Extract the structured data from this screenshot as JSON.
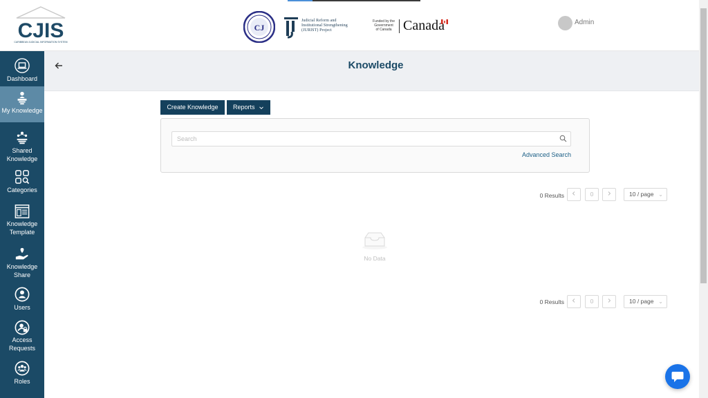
{
  "header": {
    "logo_text": "CJIS",
    "logo_caption": "CARIBBEAN JUDICIAL INFORMATION SYSTEM",
    "seal_text": "CCJ",
    "jurist_lines": [
      "Judicial Reform and",
      "Institutional Strengthening",
      "(JURIST) Project"
    ],
    "funded_lines": [
      "Funded by the",
      "Government",
      "of Canada"
    ],
    "canada_wordmark": "Canada",
    "user_name": "Admin"
  },
  "sidebar": {
    "items": [
      {
        "id": "dashboard",
        "label": "Dashboard",
        "icon": "laptop-icon"
      },
      {
        "id": "my-knowledge",
        "label": "My Knowledge",
        "icon": "person-podium-icon",
        "active": true
      },
      {
        "id": "shared-knowledge",
        "label": "Shared Knowledge",
        "icon": "share-nodes-icon"
      },
      {
        "id": "categories",
        "label": "Categories",
        "icon": "category-search-icon"
      },
      {
        "id": "knowledge-template",
        "label": "Knowledge Template",
        "icon": "template-icon"
      },
      {
        "id": "knowledge-share",
        "label": "Knowledge Share",
        "icon": "hand-share-icon"
      },
      {
        "id": "users",
        "label": "Users",
        "icon": "user-circle-icon"
      },
      {
        "id": "access-requests",
        "label": "Access Requests",
        "icon": "user-lock-icon"
      },
      {
        "id": "roles",
        "label": "Roles",
        "icon": "users-group-icon"
      }
    ]
  },
  "main": {
    "title": "Knowledge",
    "create_label": "Create Knowledge",
    "reports_label": "Reports",
    "search_placeholder": "Search",
    "advanced_search_label": "Advanced Search",
    "results_text": "0 Results",
    "current_page": "0",
    "page_size_label": "10 / page",
    "empty_text": "No Data"
  },
  "colors": {
    "sidebar_bg": "#1b4a66",
    "sidebar_active": "#5d8aa6",
    "primary_button": "#14405c",
    "title_color": "#1b4a66",
    "chat_button": "#1a73e8"
  }
}
